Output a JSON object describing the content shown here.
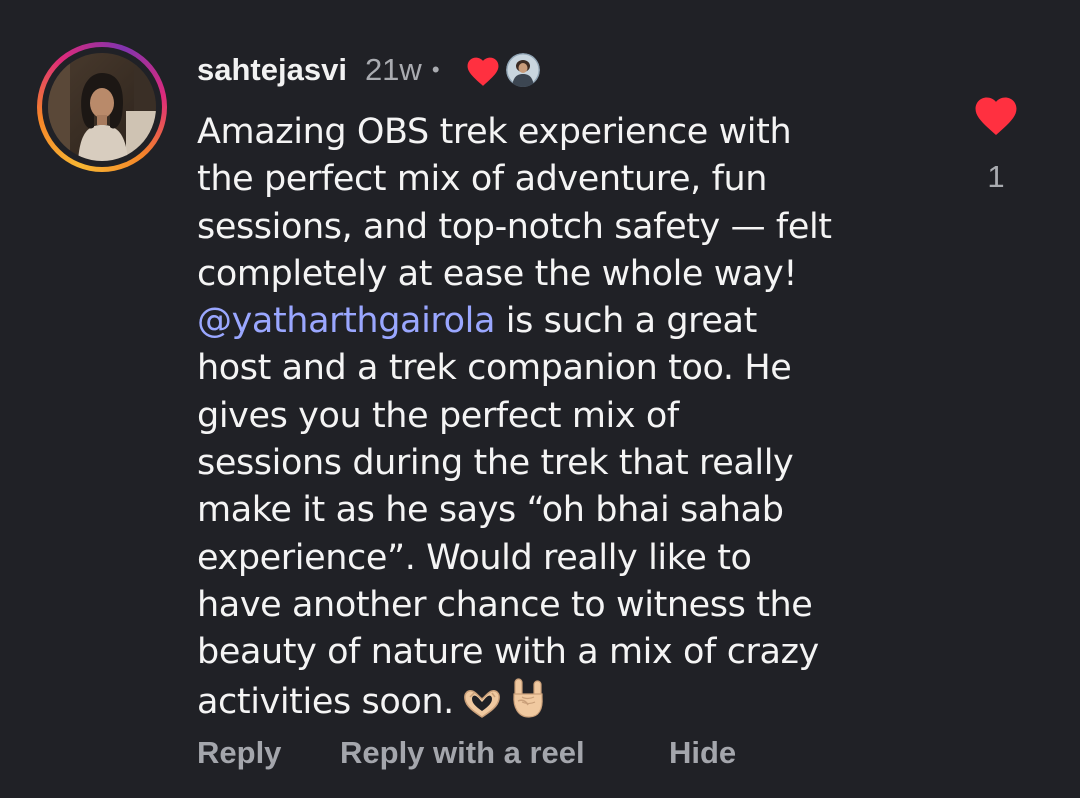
{
  "comment": {
    "username": "sahtejasvi",
    "timestamp": "21w",
    "separator": "•",
    "lines": [
      "Amazing OBS trek experience with",
      "the perfect mix of adventure, fun",
      "sessions, and top-notch safety — felt",
      "completely at ease the whole way!"
    ],
    "mention": "@yatharthgairola",
    "mention_suffix": " is such a great",
    "lines_after": [
      "host and a trek companion too. He",
      "gives you the perfect mix of",
      "sessions during the trek that really",
      "make it as he says “oh bhai sahab",
      "experience”. Would really like to",
      "have another chance to witness the",
      "beauty of nature with a mix of crazy"
    ],
    "last_line": "activities soon.",
    "emojis": [
      "heart-hands-emoji",
      "rock-on-hand-emoji"
    ]
  },
  "actions": {
    "reply_label": "Reply",
    "reply_reel_label": "Reply with a reel",
    "hide_label": "Hide"
  },
  "like": {
    "count": "1",
    "color": "#ff3040"
  },
  "icons": [
    "profile-avatar",
    "creator-liked-heart-icon",
    "creator-avatar",
    "like-heart-icon"
  ],
  "colors": {
    "background": "#202126",
    "text": "#f4f4f4",
    "muted": "#a9abb0",
    "mention": "#9aa7ff",
    "heart": "#ff3040"
  }
}
